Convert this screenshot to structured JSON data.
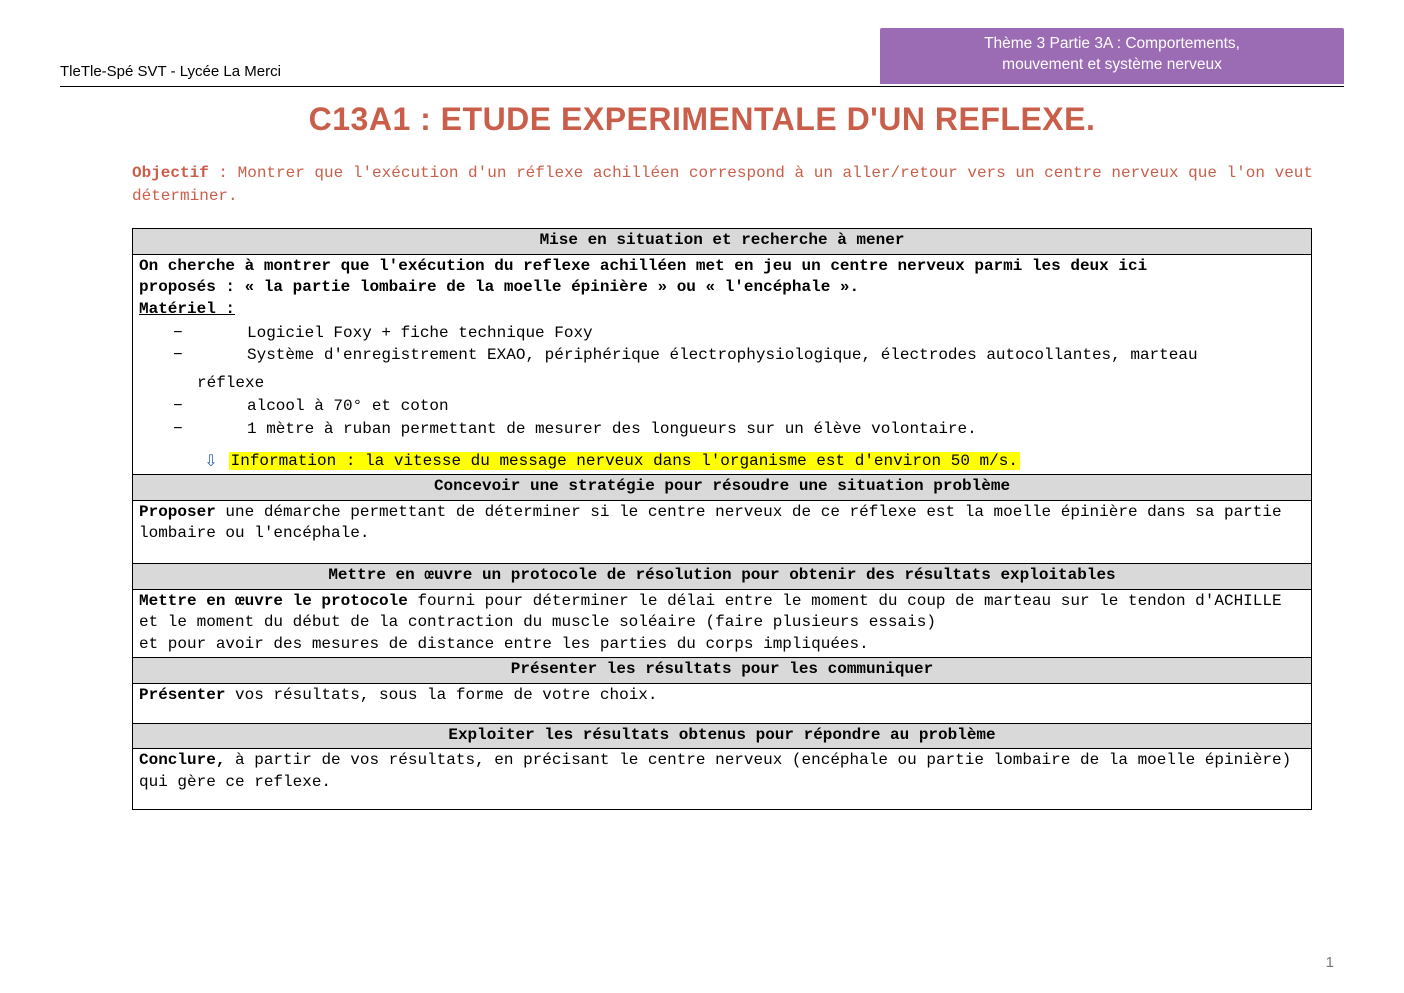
{
  "header": {
    "left": "TleTle-Spé SVT - Lycée La Merci",
    "right_line1": "Thème 3 Partie 3A : Comportements,",
    "right_line2": "mouvement et système nerveux"
  },
  "title": "C13A1 : ETUDE EXPERIMENTALE D'UN REFLEXE.",
  "objectif": {
    "label": "Objectif",
    "text": " : Montrer que l'exécution d'un réflexe achilléen correspond à un aller/retour vers un centre nerveux que l'on veut déterminer."
  },
  "sections": {
    "mise_hdr": "Mise en situation et recherche à mener",
    "mise_intro1": "On cherche à montrer que l'exécution du reflexe achilléen met en jeu un centre nerveux parmi les deux ici",
    "mise_intro2": "proposés : « la partie lombaire de la moelle épinière » ou « l'encéphale ».",
    "materiel_label": "Matériel :",
    "materiel": [
      "Logiciel Foxy + fiche technique Foxy",
      "Système d'enregistrement EXAO, périphérique électrophysiologique, électrodes autocollantes, marteau",
      "alcool à 70° et coton",
      "1 mètre à ruban permettant de mesurer des longueurs sur un élève volontaire."
    ],
    "materiel_cont": "réflexe",
    "info_text": "Information : la vitesse du message nerveux dans l'organisme est d'environ 50 m/s.",
    "concevoir_hdr": "Concevoir une stratégie pour résoudre une situation problème",
    "concevoir_body_bold": "Proposer",
    "concevoir_body_rest": " une démarche permettant de déterminer si le centre nerveux de ce réflexe est la moelle épinière dans sa partie lombaire ou l'encéphale.",
    "mettre_hdr": "Mettre en œuvre un protocole de résolution pour obtenir des résultats exploitables",
    "mettre_body_bold": "Mettre en œuvre le protocole",
    "mettre_body_rest1": " fourni pour déterminer le délai entre le moment du coup de marteau sur le tendon d'ACHILLE et le moment du début de la contraction du muscle soléaire (faire plusieurs essais)",
    "mettre_body_rest2": " et pour avoir des mesures de distance entre les parties du corps impliquées.",
    "presenter_hdr": "Présenter les résultats pour les communiquer",
    "presenter_body_bold": "Présenter",
    "presenter_body_rest": " vos résultats, sous la forme de votre choix.",
    "exploiter_hdr": "Exploiter les résultats obtenus pour répondre au problème",
    "exploiter_body_bold": "Conclure,",
    "exploiter_body_rest": " à partir de vos résultats, en précisant le centre nerveux (encéphale ou partie lombaire de la moelle épinière) qui gère ce reflexe."
  },
  "page_number": "1"
}
